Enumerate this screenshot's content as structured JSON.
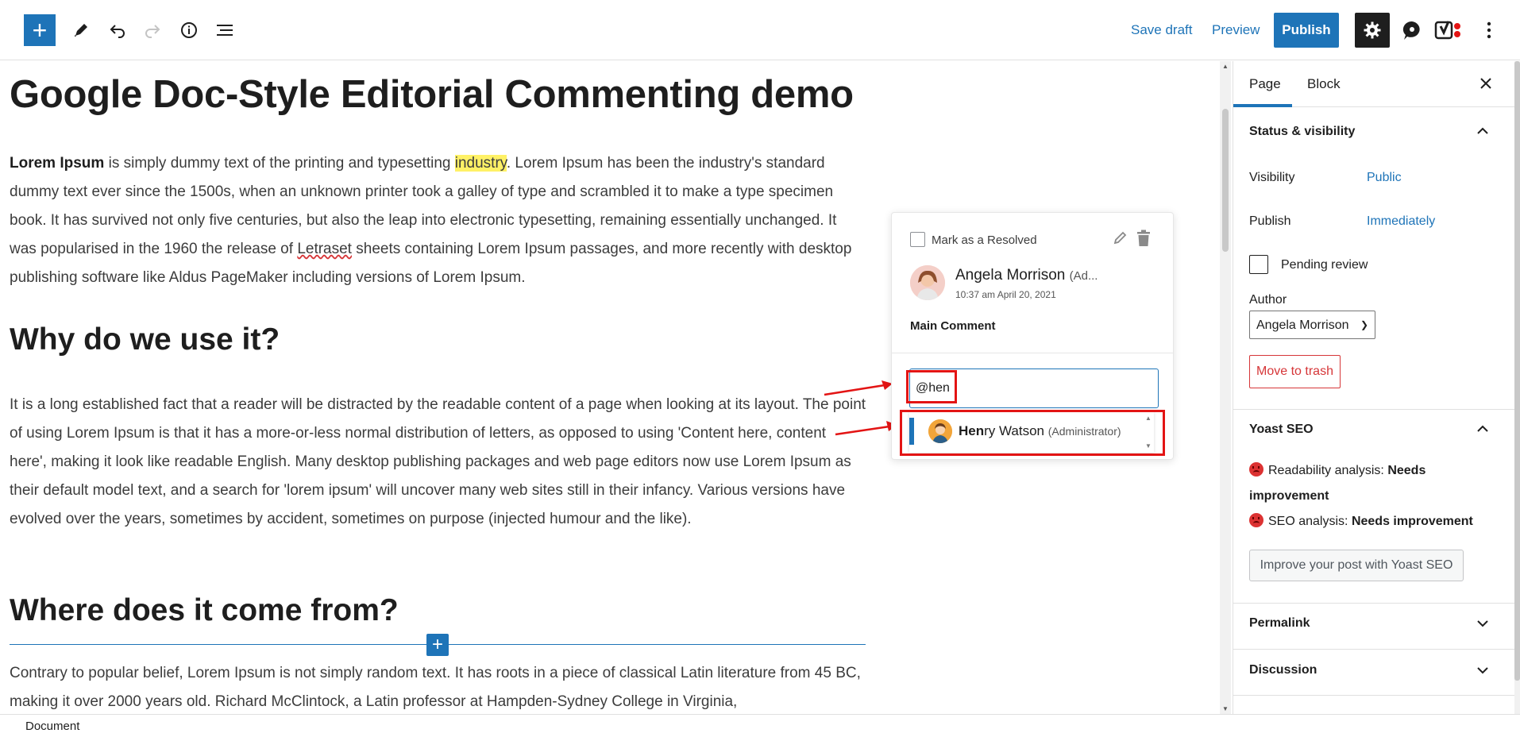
{
  "toolbar": {
    "add_icon": "plus-icon",
    "tools_icon": "pencil-icon",
    "undo_icon": "undo-icon",
    "redo_icon": "redo-icon",
    "details_icon": "info-icon",
    "outline_icon": "list-view-icon",
    "save_draft": "Save draft",
    "preview": "Preview",
    "publish": "Publish",
    "settings_icon": "gear-icon",
    "comments_icon": "comment-bubble-icon",
    "yoast_icon": "yoast-logo-icon",
    "more_icon": "more-vertical-icon"
  },
  "post": {
    "title": "Google Doc-Style Editorial Commenting demo",
    "p1_bold": "Lorem Ipsum",
    "p1_a": " is simply dummy text of the printing and typesetting ",
    "p1_highlight": "industry",
    "p1_b": ". Lorem Ipsum has been the industry's standard dummy text ever since the 1500s, when an unknown printer took a galley of type and scrambled it to make a type specimen book. It has survived not only five centuries, but also the leap into electronic typesetting, remaining essentially unchanged. It was popularised in the 1960 the release of ",
    "p1_misspelled": "Letraset",
    "p1_c": " sheets containing Lorem Ipsum passages, and more recently with desktop publishing software like Aldus PageMaker including versions of Lorem Ipsum.",
    "h2_1": "Why do we use it?",
    "p2": "It is a long established fact that a reader will be distracted by the readable content of a page when looking at its layout. The point of using Lorem Ipsum is that it has a more-or-less normal distribution of letters, as opposed to using 'Content here, content here', making it look like readable English. Many desktop publishing packages and web page editors now use Lorem Ipsum as their default model text, and a search for 'lorem ipsum' will uncover many web sites still in their infancy. Various versions have evolved over the years, sometimes by accident, sometimes on purpose (injected humour and the like).",
    "h2_2": "Where does it come from?",
    "p3": "Contrary to popular belief, Lorem Ipsum is not simply random text. It has roots in a piece of classical Latin literature from 45 BC, making it over 2000 years old. Richard McClintock, a Latin professor at Hampden-Sydney College in Virginia,"
  },
  "comment": {
    "resolve_label": "Mark as a Resolved",
    "edit_icon": "pencil-icon",
    "delete_icon": "trash-icon",
    "author_name": "Angela Morrison",
    "author_role": "(Ad...",
    "time": "10:37 am April 20, 2021",
    "body": "Main Comment",
    "reply_value": "@hen",
    "mention": {
      "match": "Hen",
      "rest": "ry Watson",
      "role": "(Administrator)"
    }
  },
  "sidebar": {
    "tabs": [
      "Page",
      "Block"
    ],
    "close_icon": "close-icon",
    "status_title": "Status & visibility",
    "visibility_label": "Visibility",
    "visibility_value": "Public",
    "publish_label": "Publish",
    "publish_value": "Immediately",
    "pending_label": "Pending review",
    "author_label": "Author",
    "author_value": "Angela Morrison",
    "trash_label": "Move to trash",
    "yoast_title": "Yoast SEO",
    "readability_label": "Readability analysis:",
    "readability_value": "Needs improvement",
    "seo_label": "SEO analysis:",
    "seo_value": "Needs improvement",
    "improve_label": "Improve your post with Yoast SEO",
    "permalink_title": "Permalink",
    "discussion_title": "Discussion"
  },
  "footer": {
    "breadcrumb": "Document"
  },
  "colors": {
    "accent": "#1e74b8",
    "highlight": "#fff166",
    "annotation_red": "#e31414",
    "danger": "#d63638"
  }
}
